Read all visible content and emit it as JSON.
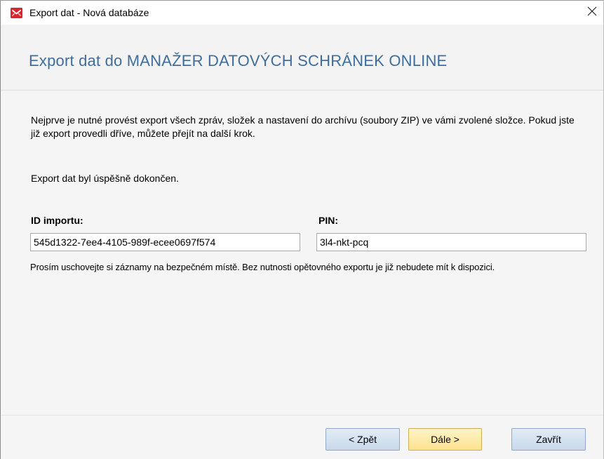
{
  "window": {
    "title": "Export dat - Nová databáze",
    "accent_color": "#d8262e"
  },
  "header": {
    "title": "Export dat do MANAŽER DATOVÝCH SCHRÁNEK ONLINE",
    "title_color": "#3f6e9c"
  },
  "content": {
    "description": "Nejprve je nutné provést export všech zpráv, složek a nastavení do archívu (soubory ZIP) ve vámi zvolené složce. Pokud jste již export provedli dříve, můžete přejít na další krok.",
    "status": "Export dat byl úspěšně dokončen.",
    "import_id": {
      "label": "ID importu:",
      "value": "545d1322-7ee4-4105-989f-ecee0697f574"
    },
    "pin": {
      "label": "PIN:",
      "value": "3l4-nkt-pcq"
    },
    "note": "Prosím uschovejte si záznamy na bezpečném místě. Bez nutnosti opětovného exportu je již nebudete mít k dispozici."
  },
  "footer": {
    "back_label": "< Zpět",
    "next_label": "Dále >",
    "close_label": "Zavřít"
  }
}
